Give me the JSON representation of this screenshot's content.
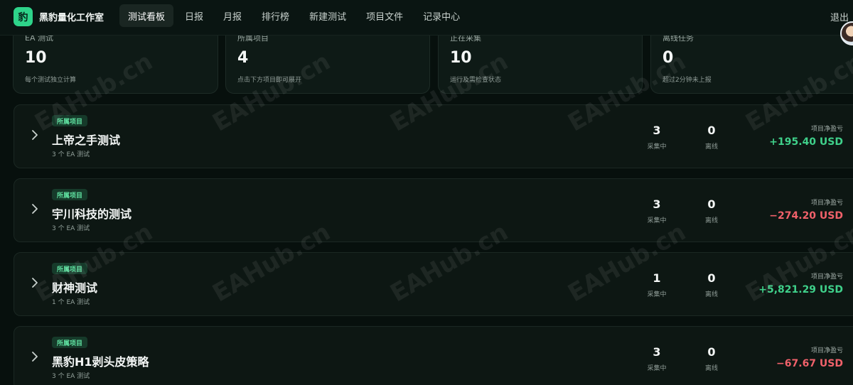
{
  "app": {
    "logo_glyph": "豹",
    "brand": "黑豹量化工作室",
    "logout": "退出"
  },
  "nav": [
    {
      "label": "测试看板",
      "active": true
    },
    {
      "label": "日报"
    },
    {
      "label": "月报"
    },
    {
      "label": "排行榜"
    },
    {
      "label": "新建测试"
    },
    {
      "label": "项目文件"
    },
    {
      "label": "记录中心"
    }
  ],
  "stats": [
    {
      "label": "EA 测试",
      "value": "10",
      "sub": "每个测试独立计算"
    },
    {
      "label": "所属项目",
      "value": "4",
      "sub": "点击下方项目即可展开"
    },
    {
      "label": "正在采集",
      "value": "10",
      "sub": "运行及需检查状态"
    },
    {
      "label": "离线任务",
      "value": "0",
      "sub": "超过2分钟未上报"
    }
  ],
  "projects": [
    {
      "badge": "所属项目",
      "name": "上帝之手测试",
      "sub": "3 个 EA 测试",
      "collecting": "3",
      "collecting_label": "采集中",
      "offline": "0",
      "offline_label": "离线",
      "pnl_label": "项目净盈亏",
      "pnl": "+195.40 USD",
      "pnl_color": "#3fd08a"
    },
    {
      "badge": "所属项目",
      "name": "宇川科技的测试",
      "sub": "3 个 EA 测试",
      "collecting": "3",
      "collecting_label": "采集中",
      "offline": "0",
      "offline_label": "离线",
      "pnl_label": "项目净盈亏",
      "pnl": "−274.20 USD",
      "pnl_color": "#f0616a"
    },
    {
      "badge": "所属项目",
      "name": "财神测试",
      "sub": "1 个 EA 测试",
      "collecting": "1",
      "collecting_label": "采集中",
      "offline": "0",
      "offline_label": "离线",
      "pnl_label": "项目净盈亏",
      "pnl": "+5,821.29 USD",
      "pnl_color": "#3fd08a"
    },
    {
      "badge": "所属项目",
      "name": "黑豹H1剥头皮策略",
      "sub": "3 个 EA 测试",
      "collecting": "3",
      "collecting_label": "采集中",
      "offline": "0",
      "offline_label": "离线",
      "pnl_label": "项目净盈亏",
      "pnl": "−67.67 USD",
      "pnl_color": "#f0616a"
    }
  ],
  "watermark": "EAHub.cn",
  "colors": {
    "accent": "#2ed48a",
    "positive": "#3fd08a",
    "negative": "#f0616a",
    "background": "#07100d"
  }
}
